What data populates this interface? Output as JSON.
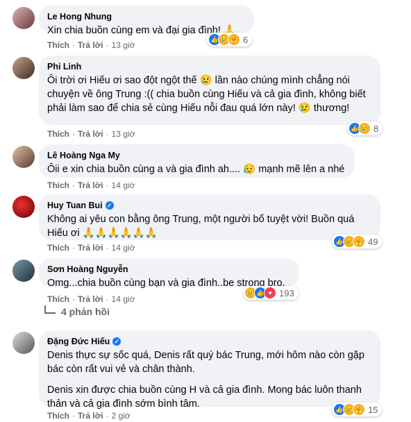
{
  "comments": [
    {
      "author": "Le Hong Nhung",
      "verified": false,
      "paragraphs": [
        "Xin chia buồn cùng em và đại gia đình! 🙏"
      ],
      "like": "Thích",
      "reply": "Trả lời",
      "time": "13 giờ",
      "reaction_count": "6",
      "reactions": [
        "like",
        "sad",
        "care"
      ]
    },
    {
      "author": "Phi Linh",
      "verified": false,
      "paragraphs": [
        "Ôi trời ơi Hiếu ơi sao đột ngột thế 😢 lần nào chúng mình chẳng nói chuyện về ông Trung :(( chia buồn cùng Hiếu và cả gia đình, không biết phải làm sao để chia sẻ cùng Hiếu nỗi đau quá lớn này! 😢 thương!"
      ],
      "like": "Thích",
      "reply": "Trả lời",
      "time": "13 giờ",
      "reaction_count": "8",
      "reactions": [
        "like",
        "sad"
      ]
    },
    {
      "author": "Lê Hoàng Nga My",
      "verified": false,
      "paragraphs": [
        "Ôii e xin chia buồn cùng a và gia đình ah.... 😥 mạnh mẽ lên a nhé"
      ],
      "like": "Thích",
      "reply": "Trả lời",
      "time": "14 giờ"
    },
    {
      "author": "Huy Tuan Bui",
      "verified": true,
      "paragraphs": [
        "Không ai yêu con bằng ông Trung, một người bố tuyệt vời! Buồn quá Hiếu ơi 🙏🙏🙏🙏🙏🙏"
      ],
      "like": "Thích",
      "reply": "Trả lời",
      "time": "14 giờ",
      "reaction_count": "49",
      "reactions": [
        "like",
        "sad",
        "care"
      ]
    },
    {
      "author": "Sơn Hoàng Nguyễn",
      "verified": false,
      "paragraphs": [
        "Omg...chia buồn cùng bạn và gia đình..be strong bro."
      ],
      "like": "Thích",
      "reply": "Trả lời",
      "time": "14 giờ",
      "reaction_count": "193",
      "reactions": [
        "sad",
        "like",
        "heart"
      ]
    },
    {
      "author": "Đặng Đức Hiếu",
      "verified": true,
      "paragraphs": [
        "Denis thực sự sốc quá, Denis rất quý bác Trung, mới hôm nào còn gặp bác còn rất vui vẻ và chân thành.",
        "Denis xin được chia buồn cùng H và cả gia đình. Mong bác luôn thanh thản và cả gia đình sớm bình tâm."
      ],
      "like": "Thích",
      "reply": "Trả lời",
      "time": "2 giờ",
      "reaction_count": "15",
      "reactions": [
        "like",
        "sad",
        "care"
      ]
    }
  ],
  "replies_link": "4 phản hồi",
  "colors": {
    "bubble": "#f0f2f5",
    "meta": "#65676b",
    "like": "#1877f2",
    "sad": "#f7b125",
    "heart": "#f33e58"
  }
}
